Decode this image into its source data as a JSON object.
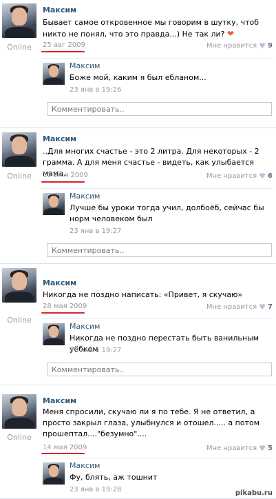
{
  "posts": [
    {
      "author": "Максим",
      "status": "Online",
      "text": "Бывает самое откровенное мы говорим в шутку, чтоб никто не понял, что это правда...) Не так ли?",
      "heart": "❤",
      "date": "25 авг 2009",
      "like_label": "Мне нравится",
      "like_count": "9",
      "reply": {
        "author": "Максим",
        "text": "Боже мой, каким я был ебланом...",
        "date": "23 янв в 19:26"
      },
      "comment_placeholder": "Комментировать.."
    },
    {
      "author": "Максим",
      "status": "Online",
      "text": "..Для многих счастье - это 2 литра. Для некоторых - 2 грамма. А для меня счастье - видеть, как улыбается мама..",
      "date": "10 июл 2009",
      "like_label": "Мне нравится",
      "like_count": "6",
      "reply": {
        "author": "Максим",
        "text": "Лучше бы уроки тогда учил, долбоёб, сейчас бы норм человеком был",
        "date": "23 янв в 19:27"
      },
      "comment_placeholder": "Комментировать.."
    },
    {
      "author": "Максим",
      "status": "Online",
      "text": "Никогда не поздно написать: «Привет, я скучаю»",
      "date": "28 мая 2009",
      "like_label": "Мне нравится",
      "like_count": "7",
      "reply": {
        "author": "Максим",
        "text": "Никогда не поздно перестать быть ванильным уёбком",
        "date": "23 янв в 19:27"
      },
      "comment_placeholder": "Комментировать.."
    },
    {
      "author": "Максим",
      "status": "Online",
      "text": "Меня спросили, скучаю ли я по тебе. Я не ответил, а просто закрыл глаза, улыбнулся и отошел..... а потом прошептал....\"безумно\"....",
      "date": "14 мая 2009",
      "like_label": "Мне нравится",
      "like_count": "5",
      "reply": {
        "author": "Максим",
        "text": "Фу, блять, аж тошнит",
        "date": "23 янв в 19:28"
      }
    }
  ],
  "watermark": "pikabu.ru",
  "colors": {
    "link": "#2b587a",
    "underline": "#d9242a",
    "heart": "#e8612c"
  }
}
